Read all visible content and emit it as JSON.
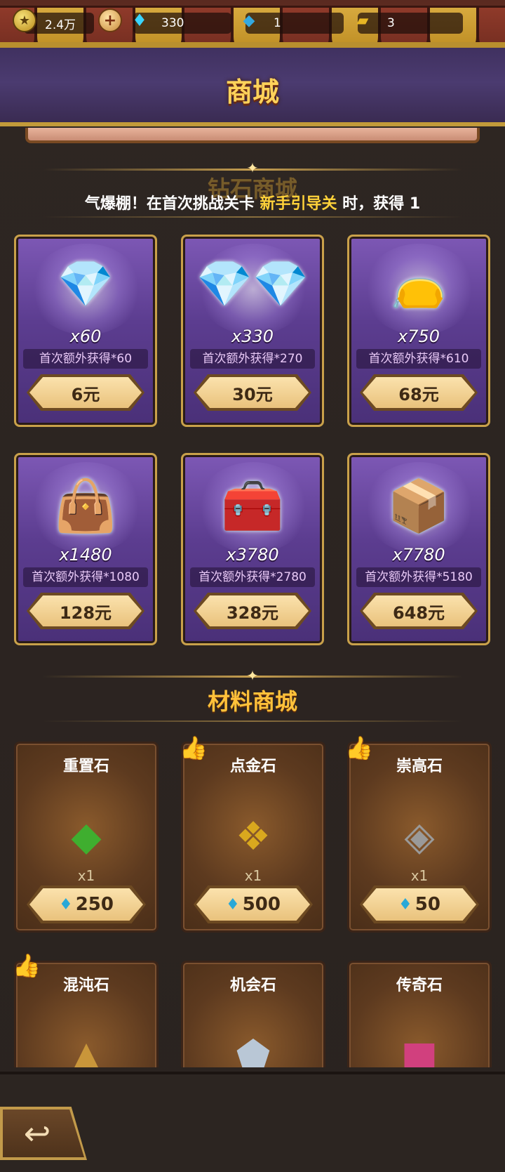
{
  "resources": {
    "gold": "2.4万",
    "diamonds": "330",
    "fish": "1",
    "tickets": "3",
    "icons": [
      "coin-icon",
      "plus-icon",
      "diamond-icon",
      "fish-icon",
      "ticket-icon"
    ]
  },
  "header": {
    "title": "商城"
  },
  "diamond_shop": {
    "title": "钻石商城",
    "marquee": {
      "prefix": "气爆棚！在首次挑战关卡 ",
      "highlight": "新手引导关",
      "suffix": " 时，获得 1"
    },
    "items": [
      {
        "qty": "x60",
        "bonus": "首次额外获得*60",
        "price": "6元"
      },
      {
        "qty": "x330",
        "bonus": "首次额外获得*270",
        "price": "30元"
      },
      {
        "qty": "x750",
        "bonus": "首次额外获得*610",
        "price": "68元"
      },
      {
        "qty": "x1480",
        "bonus": "首次额外获得*1080",
        "price": "128元"
      },
      {
        "qty": "x3780",
        "bonus": "首次额外获得*2780",
        "price": "328元"
      },
      {
        "qty": "x7780",
        "bonus": "首次额外获得*5180",
        "price": "648元"
      }
    ]
  },
  "material_shop": {
    "title": "材料商城",
    "items": [
      {
        "name": "重置石",
        "qty": "x1",
        "price": "250",
        "color": "#3fae2f"
      },
      {
        "name": "点金石",
        "qty": "x1",
        "price": "500",
        "color": "#d9a81e"
      },
      {
        "name": "崇高石",
        "qty": "x1",
        "price": "50",
        "color": "#8a8a8a"
      },
      {
        "name": "混沌石",
        "qty": "",
        "price": "",
        "color": "#c9963a"
      },
      {
        "name": "机会石",
        "qty": "",
        "price": "",
        "color": "#b9c7d6"
      },
      {
        "name": "传奇石",
        "qty": "",
        "price": "",
        "color": "#d1407e"
      }
    ]
  },
  "colors": {
    "accent_gold": "#ffc13a",
    "panel_purple": "#5c3d90",
    "panel_brown": "#5d3a1f"
  }
}
